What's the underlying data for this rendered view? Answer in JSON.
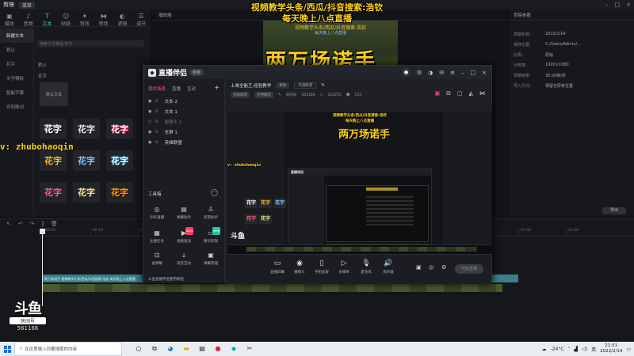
{
  "captions": {
    "line1": "视频教学头条/西瓜/抖音搜索:浩钦",
    "line2": "每天晚上八点直播",
    "big_title": "两万场诺手",
    "wechat": "v: zhubohaoqin"
  },
  "douyu": {
    "logo": "斗鱼",
    "room_label": "房间号",
    "room_number": "561166"
  },
  "bg_editor": {
    "app_name": "剪映",
    "menu": "菜单",
    "tabs": [
      "媒体",
      "音频",
      "文本",
      "贴纸",
      "特效",
      "转场",
      "滤镜",
      "调节"
    ],
    "categories": [
      "新建文本",
      "花字",
      "文字模板",
      "智能字幕",
      "识别歌词"
    ],
    "categories_sub": [
      "默认",
      "花字"
    ],
    "search_placeholder": "搜索文字模板/花字",
    "default_text": "默认文本",
    "section_default": "默认",
    "section_fancy": "花字",
    "fx_text": "花字",
    "player_label": "播放器",
    "right_panel_title": "草稿参数",
    "right_rows": [
      {
        "label": "草稿名称:",
        "value": "2022/2/14"
      },
      {
        "label": "保存位置:",
        "value": "C:/Users/Admin/..."
      },
      {
        "label": "比例:",
        "value": "原始"
      },
      {
        "label": "分辨率:",
        "value": "1920×1080"
      },
      {
        "label": "草稿帧率:",
        "value": "30.00帧/秒"
      },
      {
        "label": "导入方式:",
        "value": "保留在原有位置"
      }
    ],
    "export_label": "导出",
    "ruler": [
      "00:00",
      "00:10",
      "00:20",
      "00:30",
      "00:40",
      "00:50",
      "01:00",
      "01:10",
      "01:20",
      "01:30",
      "01:40",
      "01:50"
    ],
    "text_track": "两万场诺手 视频教学头条/西瓜/抖音搜索:浩钦 每天晚上八点直播"
  },
  "zb": {
    "name": "直播伴侣",
    "version": "新版",
    "tabs": [
      "我的场景",
      "直播",
      "互动"
    ],
    "active_tab": "我的场景",
    "layers": [
      {
        "name": "文本 2",
        "dim": false
      },
      {
        "name": "文本 1",
        "dim": false
      },
      {
        "name": "摄像头 1",
        "dim": true
      },
      {
        "name": "全屏 1",
        "dim": false
      },
      {
        "name": "英雄联盟",
        "dim": false
      }
    ],
    "tools_title": "工具箱",
    "tools": [
      {
        "label": "OBS直播",
        "icon": "obs-icon",
        "badge": ""
      },
      {
        "label": "弹幕助手",
        "icon": "danmaku-icon",
        "badge": ""
      },
      {
        "label": "房管助手",
        "icon": "admin-icon",
        "badge": ""
      },
      {
        "label": "主播任务",
        "icon": "task-icon",
        "badge": ""
      },
      {
        "label": "视频速递",
        "icon": "video-icon",
        "badge": "NEW"
      },
      {
        "label": "精华剪辑",
        "icon": "clip-icon",
        "badge": "NEW"
      },
      {
        "label": "送弹幕",
        "icon": "gift-icon",
        "badge": ""
      },
      {
        "label": "语音互动",
        "icon": "voice-icon",
        "badge": ""
      },
      {
        "label": "弹幕管理",
        "icon": "manage-icon",
        "badge": ""
      }
    ],
    "notice": "斗鱼直播伴侣使用教程",
    "room_title": "上单全能王,经验教学",
    "edit_label": "修改",
    "category": "英雄联盟",
    "chips": [
      "英雄联盟",
      "大神解说"
    ],
    "room_id_label": "房间号",
    "room_id": "561166",
    "fans": "124255",
    "viewers": "152",
    "bottom_buttons": [
      "直播屏幕",
      "摄像头",
      "手机投屏",
      "多媒体",
      "麦克风",
      "扬声器"
    ],
    "start_label": "开始直播"
  },
  "preview": {
    "cap1": "视频教学头条/西瓜/抖音搜索:浩钦",
    "cap2": "每天晚上八点直播",
    "big": "两万场诺手",
    "inner_app": "直播伴侣",
    "watermark": "v: zhubohaoqin",
    "fx_text": "花字",
    "douyu": "斗鱼"
  },
  "taskbar": {
    "search_placeholder": "在这里输入你要搜索的内容",
    "weather": "-24°C",
    "ime": "英",
    "time": "21:51",
    "date": "2022/2/14"
  }
}
